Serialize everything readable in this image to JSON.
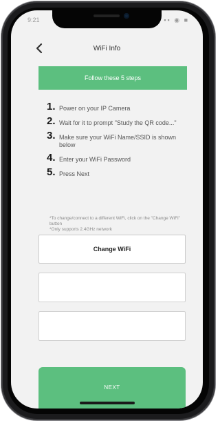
{
  "status_bar": {
    "time": "9:21",
    "icons": "▪▪ ◉ ■"
  },
  "nav": {
    "title": "WiFi Info",
    "back_icon": "chevron-left-icon"
  },
  "banner": {
    "text": "Follow these 5 steps"
  },
  "steps": [
    {
      "number": "1.",
      "text": "Power on your IP Camera"
    },
    {
      "number": "2.",
      "text": "Wait for it to prompt \"Study the QR code...\""
    },
    {
      "number": "3.",
      "text": "Make sure your WiFi Name/SSID is shown below"
    },
    {
      "number": "4.",
      "text": "Enter your WiFi Password"
    },
    {
      "number": "5.",
      "text": "Press Next"
    }
  ],
  "note": {
    "line1": "*To change/connect to a different WiFi, click on the \"Change WiFi\" button",
    "line2": "*Only supports 2.4GHz network"
  },
  "change_wifi": {
    "label": "Change WiFi"
  },
  "fields": {
    "ssid_value": "",
    "password_value": ""
  },
  "next": {
    "label": "NEXT"
  },
  "colors": {
    "accent": "#5cbf7f",
    "screen_bg": "#f2f2f2"
  }
}
